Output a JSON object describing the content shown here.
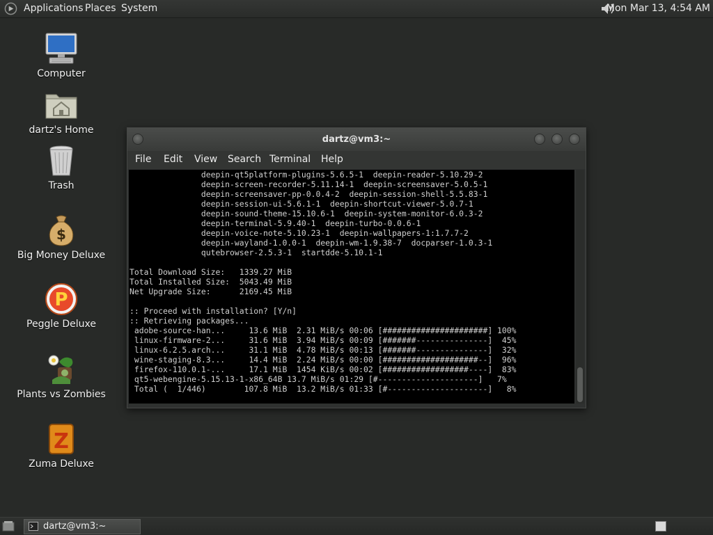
{
  "top_panel": {
    "menus": [
      "Applications",
      "Places",
      "System"
    ],
    "clock": "Mon Mar 13,  4:54 AM"
  },
  "desktop": {
    "icons": [
      {
        "label": "Computer"
      },
      {
        "label": "dartz's Home"
      },
      {
        "label": "Trash"
      },
      {
        "label": "Big Money Deluxe"
      },
      {
        "label": "Peggle Deluxe"
      },
      {
        "label": "Plants vs Zombies"
      },
      {
        "label": "Zuma Deluxe"
      }
    ]
  },
  "terminal": {
    "title": "dartz@vm3:~",
    "menu": [
      "File",
      "Edit",
      "View",
      "Search",
      "Terminal",
      "Help"
    ],
    "lines": [
      "               deepin-qt5platform-plugins-5.6.5-1  deepin-reader-5.10.29-2",
      "               deepin-screen-recorder-5.11.14-1  deepin-screensaver-5.0.5-1",
      "               deepin-screensaver-pp-0.0.4-2  deepin-session-shell-5.5.83-1",
      "               deepin-session-ui-5.6.1-1  deepin-shortcut-viewer-5.0.7-1",
      "               deepin-sound-theme-15.10.6-1  deepin-system-monitor-6.0.3-2",
      "               deepin-terminal-5.9.40-1  deepin-turbo-0.0.6-1",
      "               deepin-voice-note-5.10.23-1  deepin-wallpapers-1:1.7.7-2",
      "               deepin-wayland-1.0.0-1  deepin-wm-1.9.38-7  docparser-1.0.3-1",
      "               qutebrowser-2.5.3-1  startdde-5.10.1-1",
      "",
      "Total Download Size:   1339.27 MiB",
      "Total Installed Size:  5043.49 MiB",
      "Net Upgrade Size:      2169.45 MiB",
      "",
      ":: Proceed with installation? [Y/n]",
      ":: Retrieving packages...",
      " adobe-source-han...     13.6 MiB  2.31 MiB/s 00:06 [######################] 100%",
      " linux-firmware-2...     31.6 MiB  3.94 MiB/s 00:09 [#######---------------]  45%",
      " linux-6.2.5.arch...     31.1 MiB  4.78 MiB/s 00:13 [#######---------------]  32%",
      " wine-staging-8.3...     14.4 MiB  2.24 MiB/s 00:00 [####################--]  96%",
      " firefox-110.0.1-...     17.1 MiB  1454 KiB/s 00:02 [##################----]  83%",
      " qt5-webengine-5.15.13-1-x86_64B 13.7 MiB/s 01:29 [#---------------------]   7%",
      " Total (  1/446)        107.8 MiB  13.2 MiB/s 01:33 [#---------------------]   8%"
    ]
  },
  "taskbar": {
    "task_label": "dartz@vm3:~"
  }
}
